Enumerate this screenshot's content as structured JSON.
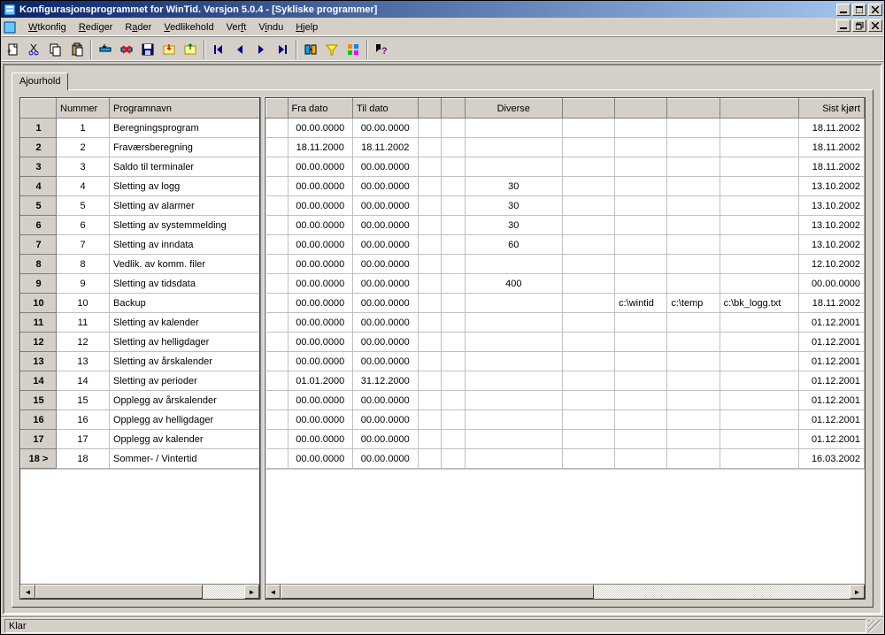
{
  "window": {
    "title": "Konfigurasjonsprogrammet for WinTid. Versjon 5.0.4 - [Sykliske programmer]"
  },
  "menu": {
    "items": [
      "Wtkonfig",
      "Rediger",
      "Rader",
      "Vedlikehold",
      "Verft",
      "Vindu",
      "Hjelp"
    ]
  },
  "tab": {
    "label": "Ajourhold"
  },
  "columns": {
    "left": [
      "",
      "Nummer",
      "Programnavn"
    ],
    "right": [
      "",
      "Fra dato",
      "Til dato",
      "",
      "",
      "Diverse",
      "",
      "",
      "",
      "",
      "Sist kjørt"
    ]
  },
  "rows": [
    {
      "n": 1,
      "name": "Beregningsprogram",
      "fra": "00.00.0000",
      "til": "00.00.0000",
      "div": "",
      "c6": "",
      "c7": "",
      "c8": "",
      "c9": "",
      "sist": "18.11.2002"
    },
    {
      "n": 2,
      "name": "Fraværsberegning",
      "fra": "18.11.2000",
      "til": "18.11.2002",
      "div": "",
      "c6": "",
      "c7": "",
      "c8": "",
      "c9": "",
      "sist": "18.11.2002"
    },
    {
      "n": 3,
      "name": "Saldo til terminaler",
      "fra": "00.00.0000",
      "til": "00.00.0000",
      "div": "",
      "c6": "",
      "c7": "",
      "c8": "",
      "c9": "",
      "sist": "18.11.2002"
    },
    {
      "n": 4,
      "name": "Sletting av logg",
      "fra": "00.00.0000",
      "til": "00.00.0000",
      "div": "30",
      "c6": "",
      "c7": "",
      "c8": "",
      "c9": "",
      "sist": "13.10.2002"
    },
    {
      "n": 5,
      "name": "Sletting av alarmer",
      "fra": "00.00.0000",
      "til": "00.00.0000",
      "div": "30",
      "c6": "",
      "c7": "",
      "c8": "",
      "c9": "",
      "sist": "13.10.2002"
    },
    {
      "n": 6,
      "name": "Sletting av systemmelding",
      "fra": "00.00.0000",
      "til": "00.00.0000",
      "div": "30",
      "c6": "",
      "c7": "",
      "c8": "",
      "c9": "",
      "sist": "13.10.2002"
    },
    {
      "n": 7,
      "name": "Sletting av inndata",
      "fra": "00.00.0000",
      "til": "00.00.0000",
      "div": "60",
      "c6": "",
      "c7": "",
      "c8": "",
      "c9": "",
      "sist": "13.10.2002"
    },
    {
      "n": 8,
      "name": "Vedlik. av komm. filer",
      "fra": "00.00.0000",
      "til": "00.00.0000",
      "div": "",
      "c6": "",
      "c7": "",
      "c8": "",
      "c9": "",
      "sist": "12.10.2002"
    },
    {
      "n": 9,
      "name": "Sletting av tidsdata",
      "fra": "00.00.0000",
      "til": "00.00.0000",
      "div": "400",
      "c6": "",
      "c7": "",
      "c8": "",
      "c9": "",
      "sist": "00.00.0000"
    },
    {
      "n": 10,
      "name": "Backup",
      "fra": "00.00.0000",
      "til": "00.00.0000",
      "div": "",
      "c6": "",
      "c7": "c:\\wintid",
      "c8": "c:\\temp",
      "c9": "c:\\bk_logg.txt",
      "sist": "18.11.2002"
    },
    {
      "n": 11,
      "name": "Sletting av kalender",
      "fra": "00.00.0000",
      "til": "00.00.0000",
      "div": "",
      "c6": "",
      "c7": "",
      "c8": "",
      "c9": "",
      "sist": "01.12.2001"
    },
    {
      "n": 12,
      "name": "Sletting av helligdager",
      "fra": "00.00.0000",
      "til": "00.00.0000",
      "div": "",
      "c6": "",
      "c7": "",
      "c8": "",
      "c9": "",
      "sist": "01.12.2001"
    },
    {
      "n": 13,
      "name": "Sletting av årskalender",
      "fra": "00.00.0000",
      "til": "00.00.0000",
      "div": "",
      "c6": "",
      "c7": "",
      "c8": "",
      "c9": "",
      "sist": "01.12.2001"
    },
    {
      "n": 14,
      "name": "Sletting av perioder",
      "fra": "01.01.2000",
      "til": "31.12.2000",
      "div": "",
      "c6": "",
      "c7": "",
      "c8": "",
      "c9": "",
      "sist": "01.12.2001"
    },
    {
      "n": 15,
      "name": "Opplegg av årskalender",
      "fra": "00.00.0000",
      "til": "00.00.0000",
      "div": "",
      "c6": "",
      "c7": "",
      "c8": "",
      "c9": "",
      "sist": "01.12.2001"
    },
    {
      "n": 16,
      "name": "Opplegg av helligdager",
      "fra": "00.00.0000",
      "til": "00.00.0000",
      "div": "",
      "c6": "",
      "c7": "",
      "c8": "",
      "c9": "",
      "sist": "01.12.2001"
    },
    {
      "n": 17,
      "name": "Opplegg av kalender",
      "fra": "00.00.0000",
      "til": "00.00.0000",
      "div": "",
      "c6": "",
      "c7": "",
      "c8": "",
      "c9": "",
      "sist": "01.12.2001"
    },
    {
      "n": 18,
      "name": "Sommer- / Vintertid",
      "fra": "00.00.0000",
      "til": "00.00.0000",
      "div": "",
      "c6": "",
      "c7": "",
      "c8": "",
      "c9": "",
      "sist": "16.03.2002"
    }
  ],
  "selected_row_marker": "18 >",
  "status": {
    "text": "Klar"
  },
  "toolbar_icons": [
    "new-icon",
    "cut-icon",
    "copy-icon",
    "paste-icon",
    "sep",
    "insert-icon",
    "delete-icon",
    "save-icon",
    "import-icon",
    "export-icon",
    "sep",
    "first-icon",
    "prev-icon",
    "next-icon",
    "last-icon",
    "sep",
    "link-icon",
    "filter-icon",
    "tools-icon",
    "sep",
    "help-icon"
  ]
}
